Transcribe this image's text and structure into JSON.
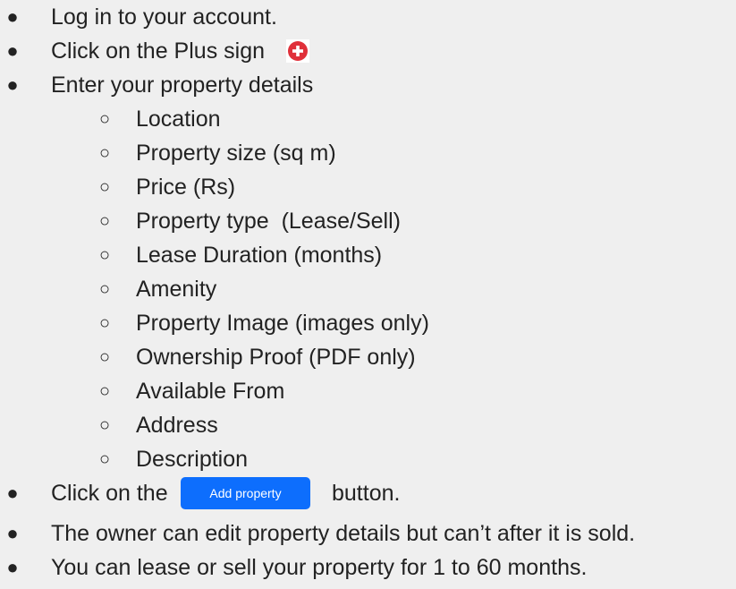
{
  "steps": {
    "login": "Log in to your account.",
    "plus": "Click on the Plus sign",
    "details": "Enter your property details",
    "click_on_the": "Click on the",
    "button_suffix": "button.",
    "owner_edit": "The owner can edit property details but can’t after it is sold.",
    "lease_sell": "You can lease or sell your property for 1 to 60 months."
  },
  "fields": [
    "Location",
    "Property size (sq m)",
    "Price (Rs)",
    "Property type  (Lease/Sell)",
    "Lease Duration (months)",
    "Amenity",
    "Property Image (images only)",
    "Ownership Proof (PDF only)",
    "Available From",
    "Address",
    "Description"
  ],
  "add_button": {
    "label": "Add property",
    "color": "#0d6efd"
  },
  "plus_icon": {
    "name": "plus-circle-icon",
    "color": "#e0303a"
  },
  "markers": {
    "bullet": "●",
    "sub_bullet": "○"
  }
}
